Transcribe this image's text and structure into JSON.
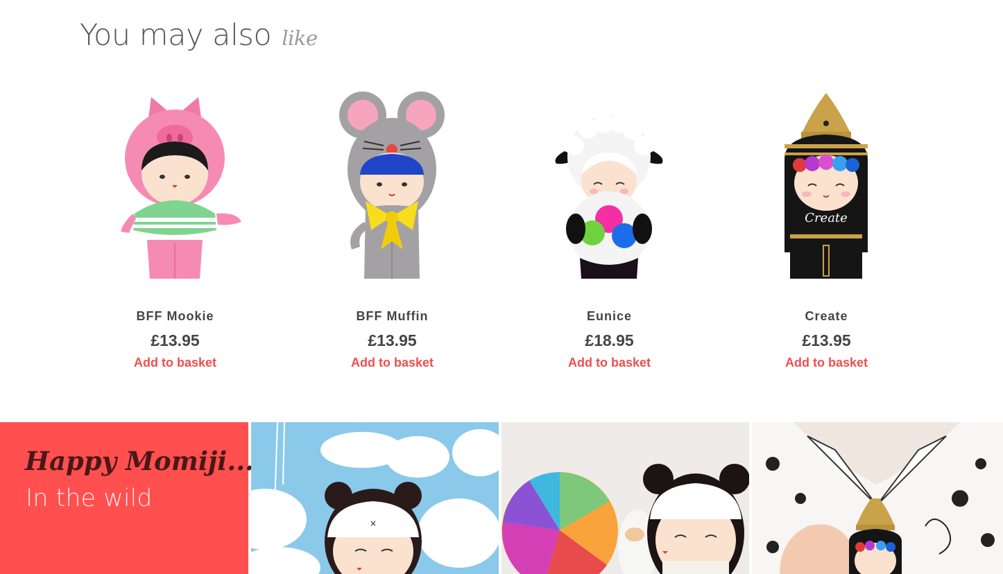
{
  "section": {
    "heading_main": "You may also",
    "heading_script": "like"
  },
  "products": [
    {
      "name": "BFF Mookie",
      "price": "£13.95",
      "cta": "Add to basket"
    },
    {
      "name": "BFF Muffin",
      "price": "£13.95",
      "cta": "Add to basket"
    },
    {
      "name": "Eunice",
      "price": "£18.95",
      "cta": "Add to basket"
    },
    {
      "name": "Create",
      "price": "£13.95",
      "cta": "Add to basket"
    }
  ],
  "wild": {
    "title_script": "Happy Momiji...",
    "subtitle": "In the wild",
    "sweater_word": "Create"
  },
  "colors": {
    "accent": "#f04e4e",
    "wild_background": "#ff4f4f",
    "text": "#444444"
  }
}
